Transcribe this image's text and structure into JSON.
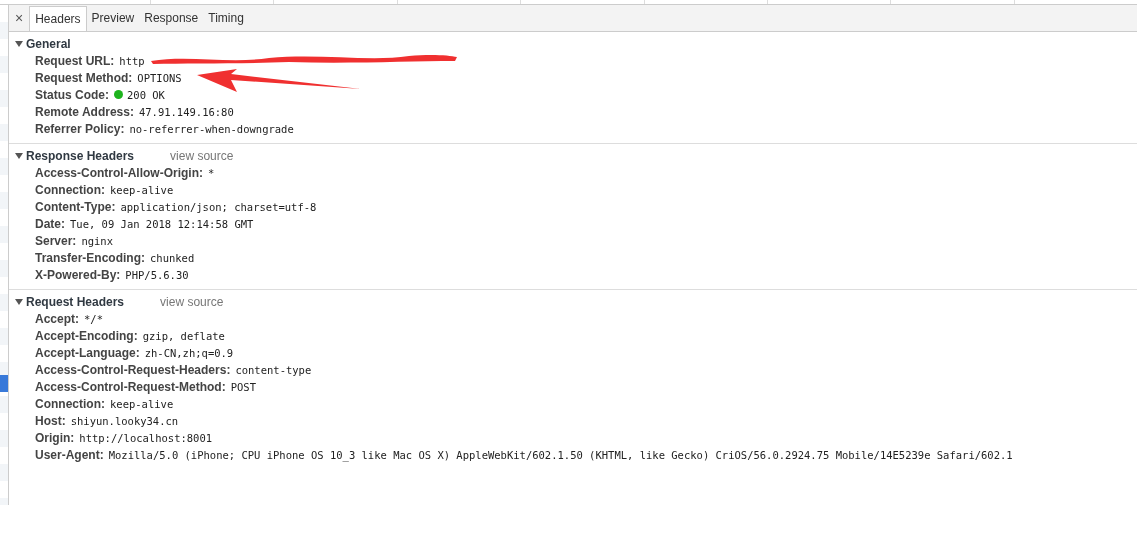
{
  "tabs": [
    {
      "label": "Headers",
      "selected": true
    },
    {
      "label": "Preview",
      "selected": false
    },
    {
      "label": "Response",
      "selected": false
    },
    {
      "label": "Timing",
      "selected": false
    }
  ],
  "close_symbol": "×",
  "sections": [
    {
      "title": "General",
      "expanded": true,
      "items": [
        {
          "name": "Request URL:",
          "value": "http",
          "redacted": true
        },
        {
          "name": "Request Method:",
          "value": "OPTIONS",
          "annotated": true
        },
        {
          "name": "Status Code:",
          "value": "200 OK",
          "color": "#1db31d"
        },
        {
          "name": "Remote Address:",
          "value": "47.91.149.16:80"
        },
        {
          "name": "Referrer Policy:",
          "value": "no-referrer-when-downgrade"
        }
      ]
    },
    {
      "title": "Response Headers",
      "link": "view source",
      "expanded": true,
      "items": [
        {
          "name": "Access-Control-Allow-Origin:",
          "value": "*"
        },
        {
          "name": "Connection:",
          "value": "keep-alive"
        },
        {
          "name": "Content-Type:",
          "value": "application/json; charset=utf-8"
        },
        {
          "name": "Date:",
          "value": "Tue, 09 Jan 2018 12:14:58 GMT"
        },
        {
          "name": "Server:",
          "value": "nginx"
        },
        {
          "name": "Transfer-Encoding:",
          "value": "chunked"
        },
        {
          "name": "X-Powered-By:",
          "value": "PHP/5.6.30"
        }
      ]
    },
    {
      "title": "Request Headers",
      "link": "view source",
      "expanded": true,
      "items": [
        {
          "name": "Accept:",
          "value": "*/*"
        },
        {
          "name": "Accept-Encoding:",
          "value": "gzip, deflate"
        },
        {
          "name": "Accept-Language:",
          "value": "zh-CN,zh;q=0.9"
        },
        {
          "name": "Access-Control-Request-Headers:",
          "value": "content-type"
        },
        {
          "name": "Access-Control-Request-Method:",
          "value": "POST"
        },
        {
          "name": "Connection:",
          "value": "keep-alive"
        },
        {
          "name": "Host:",
          "value": "shiyun.looky34.cn"
        },
        {
          "name": "Origin:",
          "value": "http://localhost:8001"
        },
        {
          "name": "User-Agent:",
          "value": "Mozilla/5.0 (iPhone; CPU iPhone OS 10_3 like Mac OS X) AppleWebKit/602.1.50 (KHTML, like Gecko) CriOS/56.0.2924.75 Mobile/14E5239e Safari/602.1"
        }
      ]
    }
  ]
}
